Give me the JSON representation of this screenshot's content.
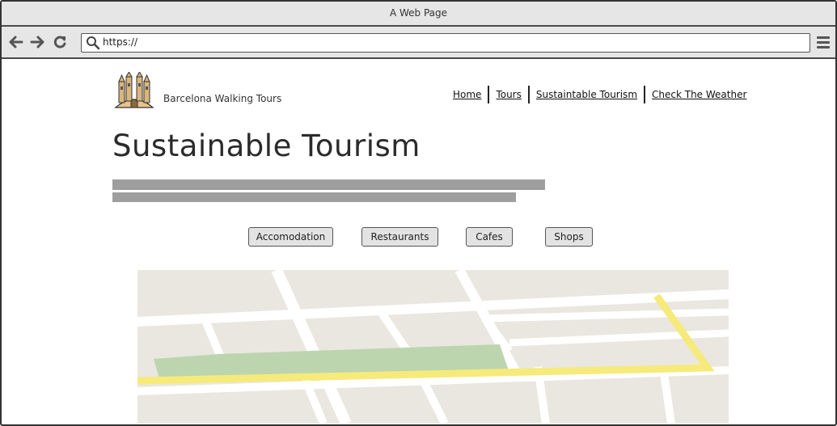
{
  "window": {
    "title": "A Web Page"
  },
  "browser": {
    "address": "https://",
    "icons": [
      "back-arrow-icon",
      "forward-arrow-icon",
      "reload-icon",
      "search-icon",
      "hamburger-menu-icon"
    ]
  },
  "site": {
    "brand_name": "Barcelona Walking Tours",
    "logo_icon": "cathedral-logo",
    "nav": [
      {
        "label": "Home"
      },
      {
        "label": "Tours"
      },
      {
        "label": "Sustaintable Tourism"
      },
      {
        "label": "Check The Weather"
      }
    ]
  },
  "page": {
    "title": "Sustainable Tourism",
    "filters": [
      {
        "label": "Accomodation"
      },
      {
        "label": "Restaurants"
      },
      {
        "label": "Cafes"
      },
      {
        "label": "Shops"
      }
    ]
  },
  "map": {
    "colors": {
      "land": "#eae7e0",
      "street": "#ffffff",
      "route": "#f6ea7a",
      "park": "#bcd5ae"
    }
  }
}
